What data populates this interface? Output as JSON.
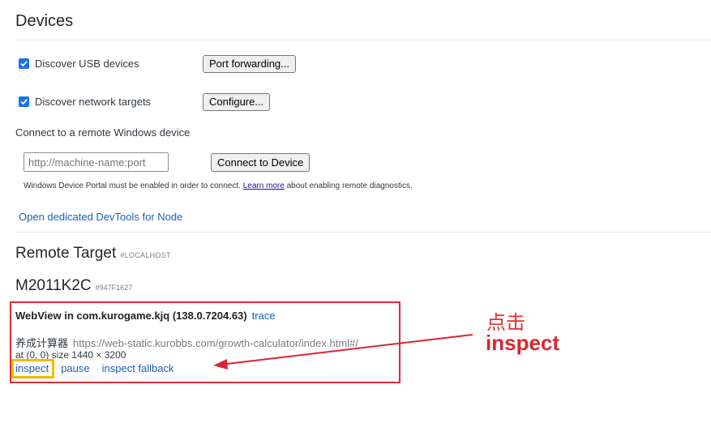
{
  "devices": {
    "heading": "Devices",
    "usb": {
      "label": "Discover USB devices",
      "checked": true,
      "button": "Port forwarding..."
    },
    "network": {
      "label": "Discover network targets",
      "checked": true,
      "button": "Configure..."
    }
  },
  "windows_connect": {
    "label": "Connect to a remote Windows device",
    "input_placeholder": "http://machine-name:port",
    "button": "Connect to Device",
    "note_before": "Windows Device Portal must be enabled in order to connect.",
    "note_link": "Learn more",
    "note_after": "about enabling remote diagnostics."
  },
  "node_link": "Open dedicated DevTools for Node",
  "remote_target": {
    "heading": "Remote Target",
    "tag": "#LOCALHOST",
    "device_name": "M2011K2C",
    "device_id": "#947F1627",
    "webview": {
      "title": "WebView in com.kurogame.kjq (138.0.7204.63)",
      "trace": "trace",
      "page_name": "养成计算器",
      "page_url": "https://web-static.kurobbs.com/growth-calculator/index.html#/",
      "geometry": "at (0, 0) size 1440 × 3200",
      "actions": [
        "inspect",
        "pause",
        "inspect fallback"
      ]
    }
  },
  "annotation": {
    "cn": "点击",
    "en": "inspect",
    "color": "#d9262f",
    "highlight_color": "#f6b800"
  }
}
